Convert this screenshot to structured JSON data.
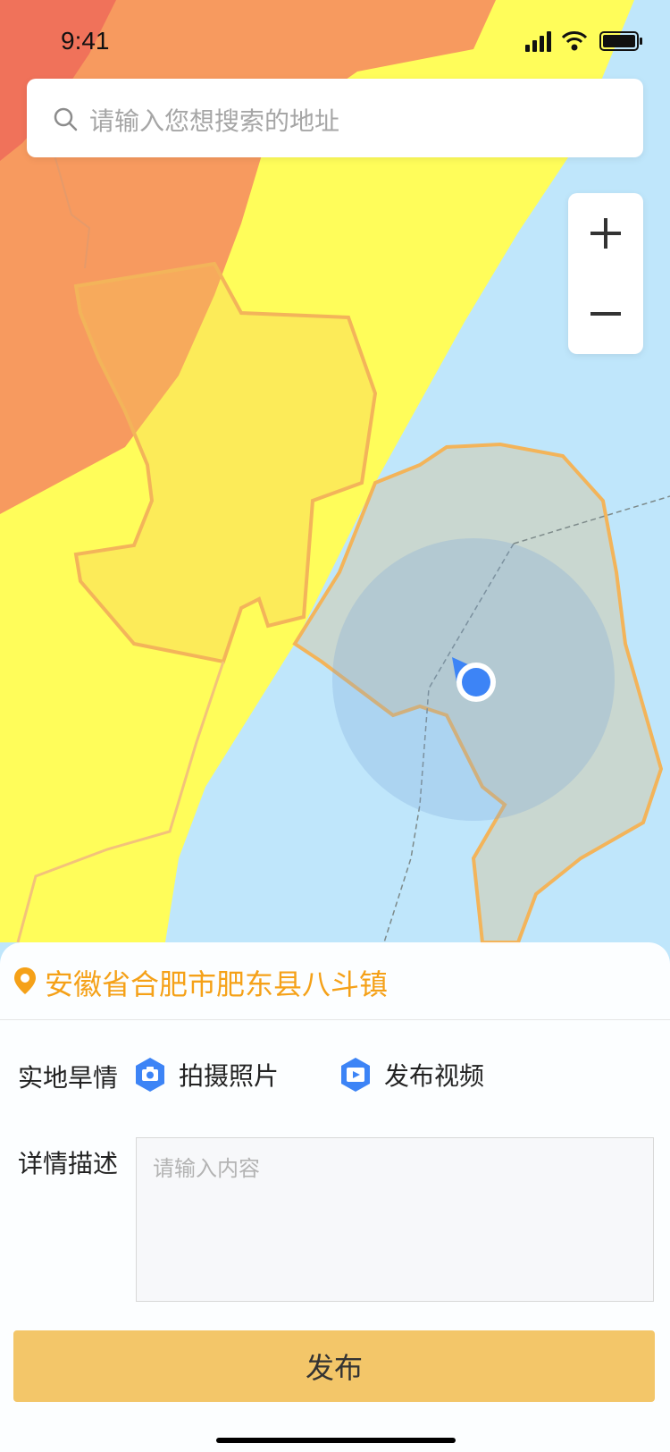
{
  "status_bar": {
    "time": "9:41"
  },
  "search": {
    "placeholder": "请输入您想搜索的地址",
    "icon": "search-icon"
  },
  "zoom": {
    "in_icon": "plus-icon",
    "out_icon": "minus-icon"
  },
  "map": {
    "colors": {
      "water": "#bfe6fb",
      "yellow": "#fffd5a",
      "orange": "#f79a5f",
      "red": "#f0725a",
      "boundary": "#f3b45a",
      "accuracy": "#7ba7d6",
      "location": "#3d84f6"
    }
  },
  "panel": {
    "location": "安徽省合肥市肥东县八斗镇",
    "location_icon": "location-pin-icon",
    "field_drought_label": "实地旱情",
    "photo_label": "拍摄照片",
    "photo_icon": "camera-icon",
    "video_label": "发布视频",
    "video_icon": "video-icon",
    "description_label": "详情描述",
    "description_placeholder": "请输入内容",
    "publish_label": "发布",
    "accent": "#f5a118",
    "publish_color": "#f3c669"
  }
}
